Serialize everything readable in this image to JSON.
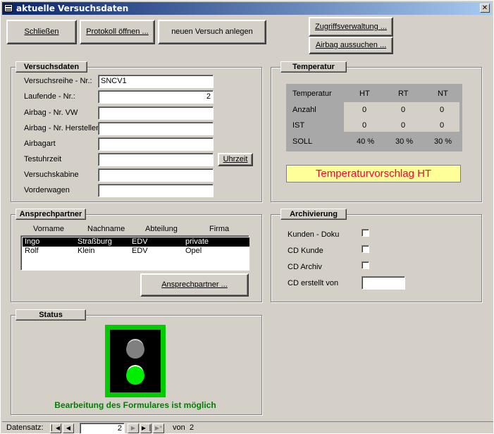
{
  "window": {
    "title": "aktuelle Versuchsdaten",
    "close_glyph": "✕"
  },
  "toolbar": {
    "close_label": "Schließen",
    "protocol_label": "Protokoll öffnen ...",
    "new_trial_label": "neuen Versuch anlegen",
    "access_label": "Zugriffsverwaltung ...",
    "airbag_label": "Airbag aussuchen ..."
  },
  "versuchsdaten": {
    "title": "Versuchsdaten",
    "fields": [
      {
        "label": "Versuchsreihe - Nr.:",
        "value": "SNCV1"
      },
      {
        "label": "Laufende - Nr.:",
        "value": "2"
      },
      {
        "label": "Airbag - Nr. VW",
        "value": ""
      },
      {
        "label": "Airbag - Nr. Hersteller",
        "value": ""
      },
      {
        "label": "Airbagart",
        "value": ""
      },
      {
        "label": "Testuhrzeit",
        "value": ""
      },
      {
        "label": "Versuchskabine",
        "value": ""
      },
      {
        "label": "Vorderwagen",
        "value": ""
      }
    ],
    "time_button": "Uhrzeit"
  },
  "temperatur": {
    "title": "Temperatur",
    "header": [
      "Temperatur",
      "HT",
      "RT",
      "NT"
    ],
    "rows": [
      {
        "label": "Anzahl",
        "values": [
          "0",
          "0",
          "0"
        ]
      },
      {
        "label": "IST",
        "values": [
          "0",
          "0",
          "0"
        ]
      },
      {
        "label": "SOLL",
        "values": [
          "40 %",
          "30 %",
          "30 %"
        ]
      }
    ],
    "suggestion": "Temperaturvorschlag HT"
  },
  "ansprechpartner": {
    "title": "Ansprechpartner",
    "columns": [
      "Vorname",
      "Nachname",
      "Abteilung",
      "Firma"
    ],
    "rows": [
      [
        "Ingo",
        "Straßburg",
        "EDV",
        "private"
      ],
      [
        "Rolf",
        "Klein",
        "EDV",
        "Opel"
      ]
    ],
    "button": "Ansprechpartner ..."
  },
  "archivierung": {
    "title": "Archivierung",
    "items": [
      {
        "label": "Kunden - Doku",
        "checked": false
      },
      {
        "label": "CD Kunde",
        "checked": false
      },
      {
        "label": "CD Archiv",
        "checked": false
      }
    ],
    "cd_created_label": "CD erstellt von",
    "cd_created_value": ""
  },
  "status": {
    "title": "Status",
    "message": "Bearbeitung des Formulares ist möglich",
    "light_state": "green",
    "colors": {
      "frame": "#00cc00",
      "green": "#00ff00",
      "inactive": "#808080",
      "message": "#008000"
    }
  },
  "navigation": {
    "label": "Datensatz:",
    "current": "2",
    "total_prefix": "von",
    "total": "2",
    "first_icon": "first-record-icon",
    "prev_icon": "previous-record-icon",
    "next_icon": "next-record-icon",
    "last_icon": "last-record-icon",
    "new_icon": "new-record-icon"
  }
}
